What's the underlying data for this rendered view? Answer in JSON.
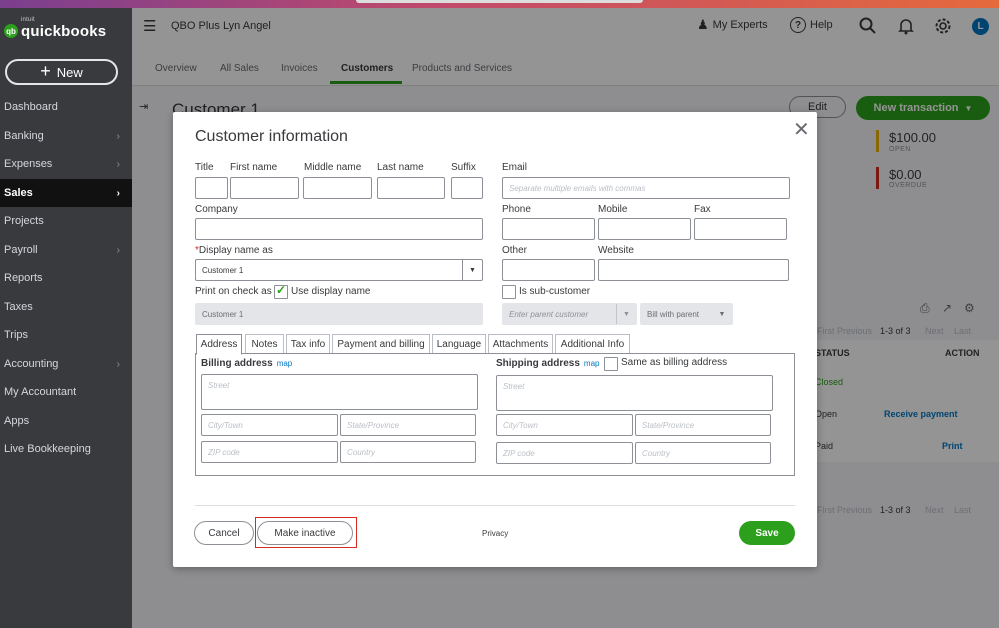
{
  "app": {
    "logo_small": "intuit",
    "logo_text": "quickbooks",
    "new_button": "New",
    "company": "QBO Plus Lyn Angel"
  },
  "sidebar": {
    "items": [
      {
        "label": "Dashboard",
        "chevron": false
      },
      {
        "label": "Banking",
        "chevron": true
      },
      {
        "label": "Expenses",
        "chevron": true
      },
      {
        "label": "Sales",
        "chevron": true,
        "active": true
      },
      {
        "label": "Projects",
        "chevron": false
      },
      {
        "label": "Payroll",
        "chevron": true
      },
      {
        "label": "Reports",
        "chevron": false
      },
      {
        "label": "Taxes",
        "chevron": false
      },
      {
        "label": "Trips",
        "chevron": false
      },
      {
        "label": "Accounting",
        "chevron": true
      },
      {
        "label": "My Accountant",
        "chevron": false
      },
      {
        "label": "Apps",
        "chevron": false
      },
      {
        "label": "Live Bookkeeping",
        "chevron": false
      }
    ]
  },
  "header": {
    "my_experts": "My Experts",
    "help": "Help",
    "avatar": "L"
  },
  "tabs": [
    "Overview",
    "All Sales",
    "Invoices",
    "Customers",
    "Products and Services"
  ],
  "background": {
    "page_title": "Customer 1",
    "edit": "Edit",
    "new_transaction": "New transaction",
    "open_amount": "$100.00",
    "open_label": "OPEN",
    "overdue_amount": "$0.00",
    "overdue_label": "OVERDUE",
    "pager": "1-3 of 3",
    "first": "First",
    "previous": "Previous",
    "next": "Next",
    "last": "Last",
    "col_status": "STATUS",
    "col_action": "ACTION",
    "row1_status": "Closed",
    "row2_status": "Open",
    "row3_status": "Paid",
    "action_receive": "Receive payment",
    "action_print": "Print"
  },
  "dialog": {
    "title": "Customer information",
    "labels": {
      "title": "Title",
      "first": "First name",
      "middle": "Middle name",
      "last": "Last name",
      "suffix": "Suffix",
      "email": "Email",
      "company": "Company",
      "phone": "Phone",
      "mobile": "Mobile",
      "fax": "Fax",
      "display": "Display name as",
      "other": "Other",
      "website": "Website",
      "print_on_check": "Print on check as",
      "use_display": "Use display name",
      "sub_customer": "Is sub-customer"
    },
    "values": {
      "display": "Customer 1",
      "print_on_check": "Customer 1",
      "bill_with_parent": "Bill with parent"
    },
    "placeholders": {
      "email": "Separate multiple emails with commas",
      "parent": "Enter parent customer",
      "street": "Street",
      "city": "City/Town",
      "state": "State/Province",
      "zip": "ZIP code",
      "country": "Country"
    },
    "tabs": [
      "Address",
      "Notes",
      "Tax info",
      "Payment and billing",
      "Language",
      "Attachments",
      "Additional Info"
    ],
    "billing_address": "Billing address",
    "shipping_address": "Shipping address",
    "map": "map",
    "same_as_billing": "Same as billing address",
    "cancel": "Cancel",
    "make_inactive": "Make inactive",
    "privacy": "Privacy",
    "save": "Save"
  },
  "colors": {
    "green": "#2ca01c",
    "sidebar": "#393a3d",
    "highlight": "#d52b1e",
    "link": "#0077c5"
  }
}
